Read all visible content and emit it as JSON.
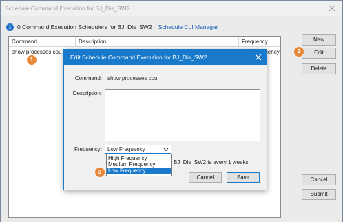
{
  "window": {
    "title": "Schedule Command Execution for BJ_Dis_SW2"
  },
  "info": {
    "text": "0 Command Execution Schedulers for BJ_Dis_SW2",
    "link": "Schedule CLI Manager"
  },
  "grid": {
    "columns": [
      "Command",
      "Description",
      "Frequency"
    ],
    "rows": [
      {
        "command": "show processes cpu",
        "description": "",
        "frequency": "Low Frequency"
      }
    ]
  },
  "side_buttons": {
    "new": "New",
    "edit": "Edit",
    "delete": "Delete",
    "cancel": "Cancel",
    "submit": "Submit"
  },
  "dialog": {
    "title": "Edit Schedule Command Execution for BJ_Dis_SW2",
    "command_label": "Command:",
    "command_value": "show processes cpu",
    "description_label": "Description:",
    "frequency_label": "Frequency:",
    "frequency_value": "Low Frequency",
    "frequency_options": [
      "High Frequency",
      "Medium Frequency",
      "Low Frequency"
    ],
    "hint_text": "BJ_Dis_SW2 is every 1 weeks",
    "cancel": "Cancel",
    "save": "Save"
  },
  "badges": [
    "1",
    "2",
    "3"
  ],
  "colors": {
    "accent": "#1979ca",
    "badge": "#e8893a",
    "info_icon": "#1f6fc5"
  },
  "icons": {
    "info": "info-icon",
    "close": "close-icon",
    "chevron": "chevron-down-icon"
  }
}
